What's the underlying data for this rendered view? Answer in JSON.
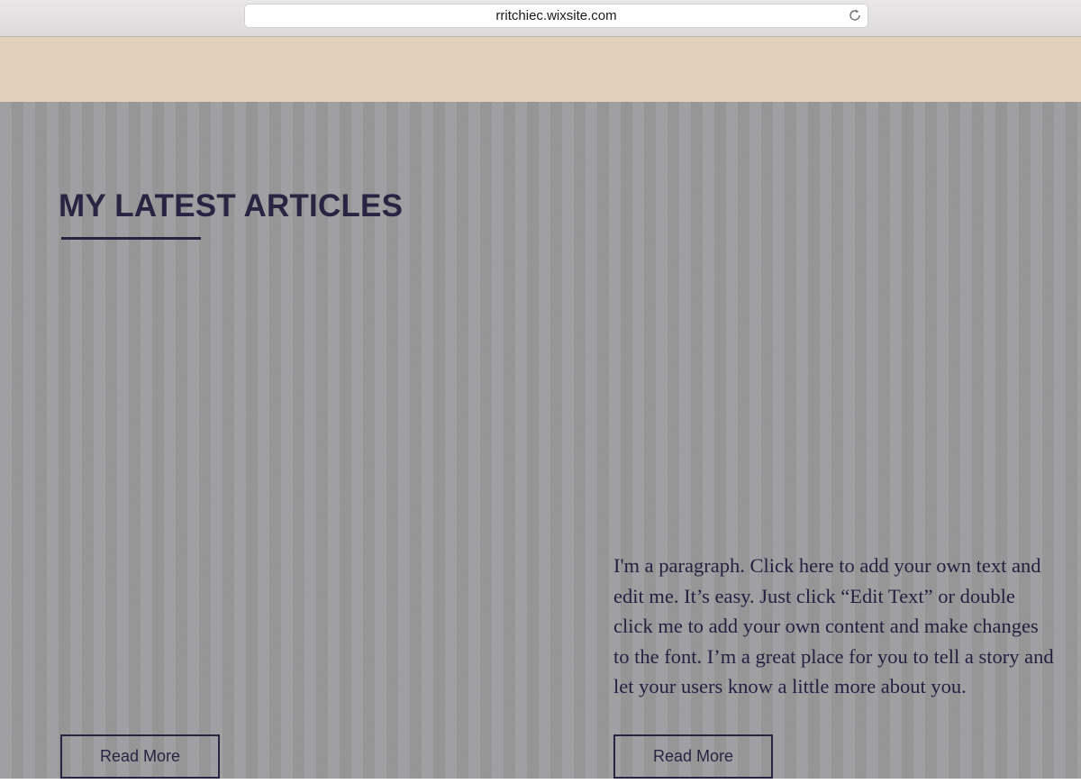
{
  "browser": {
    "url": "rritchiec.wixsite.com",
    "reload_icon": "reload-icon"
  },
  "colors": {
    "header_band": "#e0d0bc",
    "content_background": "#9b9a9c",
    "text_accent": "#2a2443"
  },
  "section": {
    "title": "MY LATEST ARTICLES"
  },
  "articles": [
    {
      "paragraph": "",
      "button_label": "Read More"
    },
    {
      "paragraph": "I'm a paragraph. Click here to add your own text and edit me. It’s easy. Just click “Edit Text” or double click me to add your own content and make changes to the font. I’m a great place for you to tell a story and let your users know a little more about you.",
      "button_label": "Read More"
    }
  ]
}
